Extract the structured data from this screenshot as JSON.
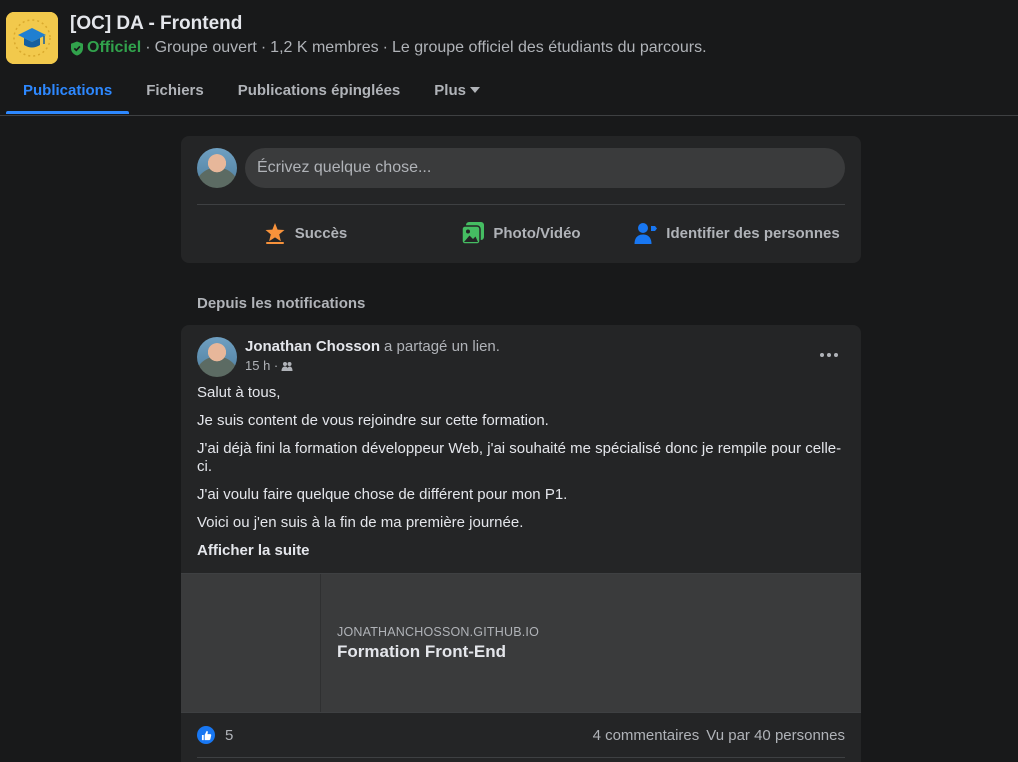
{
  "group": {
    "title": "[OC] DA - Frontend",
    "official_label": "Officiel",
    "privacy": "Groupe ouvert",
    "members": "1,2 K membres",
    "description": "Le groupe officiel des étudiants du parcours.",
    "separator": "·"
  },
  "tabs": [
    {
      "label": "Publications",
      "active": true
    },
    {
      "label": "Fichiers",
      "active": false
    },
    {
      "label": "Publications épinglées",
      "active": false
    },
    {
      "label": "Plus",
      "active": false
    }
  ],
  "composer": {
    "placeholder": "Écrivez quelque chose...",
    "actions": [
      {
        "label": "Succès",
        "icon": "star-icon",
        "color": "#f7923b"
      },
      {
        "label": "Photo/Vidéo",
        "icon": "photo-icon",
        "color": "#45bd62"
      },
      {
        "label": "Identifier des personnes",
        "icon": "tag-people-icon",
        "color": "#1877f2"
      }
    ]
  },
  "section_label": "Depuis les notifications",
  "post": {
    "author": "Jonathan Chosson",
    "action": "a partagé un lien.",
    "time": "15 h ·",
    "paragraphs": [
      "Salut à tous,",
      "Je suis content de vous rejoindre sur cette formation.",
      "J'ai déjà fini la formation développeur Web, j'ai souhaité me spécialisé donc je rempile pour celle-ci.",
      "J'ai voulu faire quelque chose de différent pour mon P1.",
      "Voici ou j'en suis à la fin de ma première journée."
    ],
    "see_more": "Afficher la suite",
    "link": {
      "domain": "JONATHANCHOSSON.GITHUB.IO",
      "title": "Formation Front-End"
    },
    "likes": "5",
    "comments": "4 commentaires",
    "seen_by": "Vu par 40 personnes"
  },
  "colors": {
    "background": "#18191a",
    "card": "#242526",
    "accent": "#2d88ff",
    "official": "#31a24c"
  }
}
